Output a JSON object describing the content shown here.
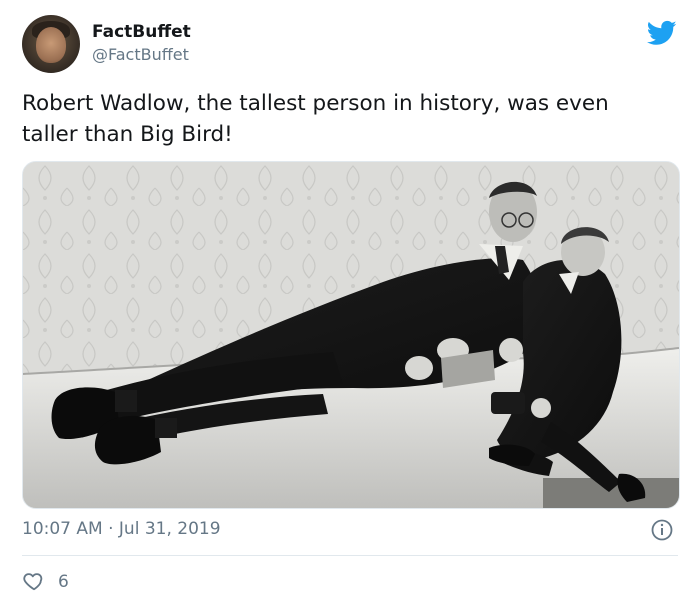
{
  "tweet": {
    "author_name": "FactBuffet",
    "author_handle": "@FactBuffet",
    "text": "Robert Wadlow, the tallest person in history, was even taller than Big Bird!",
    "timestamp": "10:07 AM · Jul 31, 2019",
    "like_count": "6"
  },
  "icons": {
    "brand": "twitter-bird-icon",
    "info": "info-icon",
    "like": "heart-icon"
  },
  "colors": {
    "twitter_blue": "#1da1f2",
    "secondary_text": "#657786",
    "primary_text": "#14171a",
    "divider": "#e1e8ed"
  }
}
